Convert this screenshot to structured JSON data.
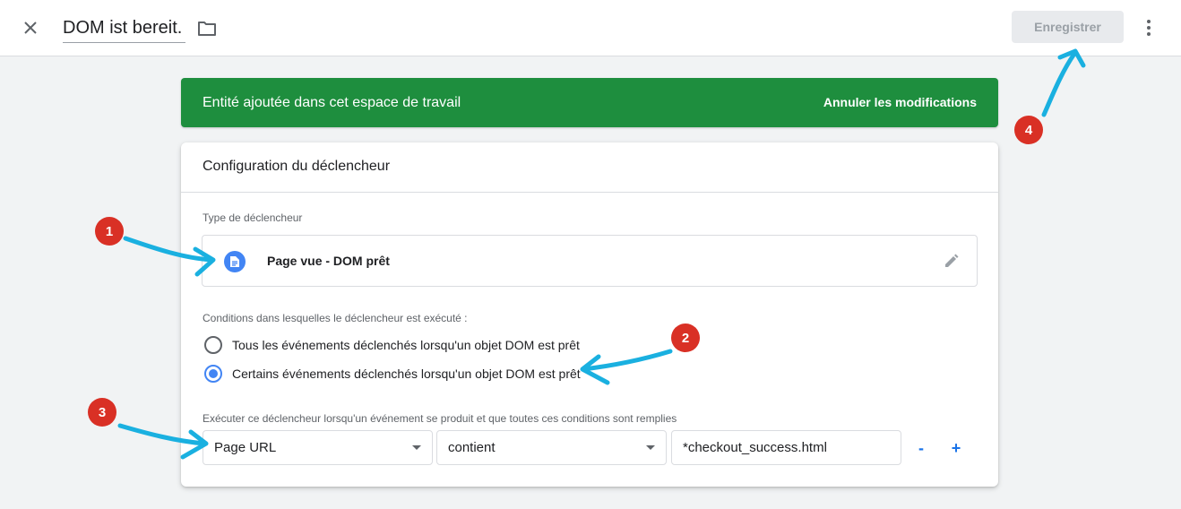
{
  "header": {
    "title": "DOM ist bereit.",
    "save_label": "Enregistrer"
  },
  "banner": {
    "message": "Entité ajoutée dans cet espace de travail",
    "action_label": "Annuler les modifications",
    "color": "#1e8e3e"
  },
  "card": {
    "title": "Configuration du déclencheur",
    "trigger_type_label": "Type de déclencheur",
    "trigger_type": {
      "name": "Page vue - DOM prêt",
      "icon": "document-icon"
    },
    "conditions_label": "Conditions dans lesquelles le déclencheur est exécuté :",
    "options": [
      {
        "label": "Tous les événements déclenchés lorsqu'un objet DOM est prêt",
        "selected": false
      },
      {
        "label": "Certains événements déclenchés lorsqu'un objet DOM est prêt",
        "selected": true
      }
    ],
    "filter_label": "Exécuter ce déclencheur lorsqu'un événement se produit et que toutes ces conditions sont remplies",
    "condition": {
      "variable": "Page URL",
      "operator": "contient",
      "value": "*checkout_success.html"
    },
    "remove_label": "-",
    "add_label": "+"
  },
  "annotations": {
    "badges": [
      "1",
      "2",
      "3",
      "4"
    ],
    "badge_color": "#d93025",
    "arrow_color": "#1ab0e0"
  }
}
